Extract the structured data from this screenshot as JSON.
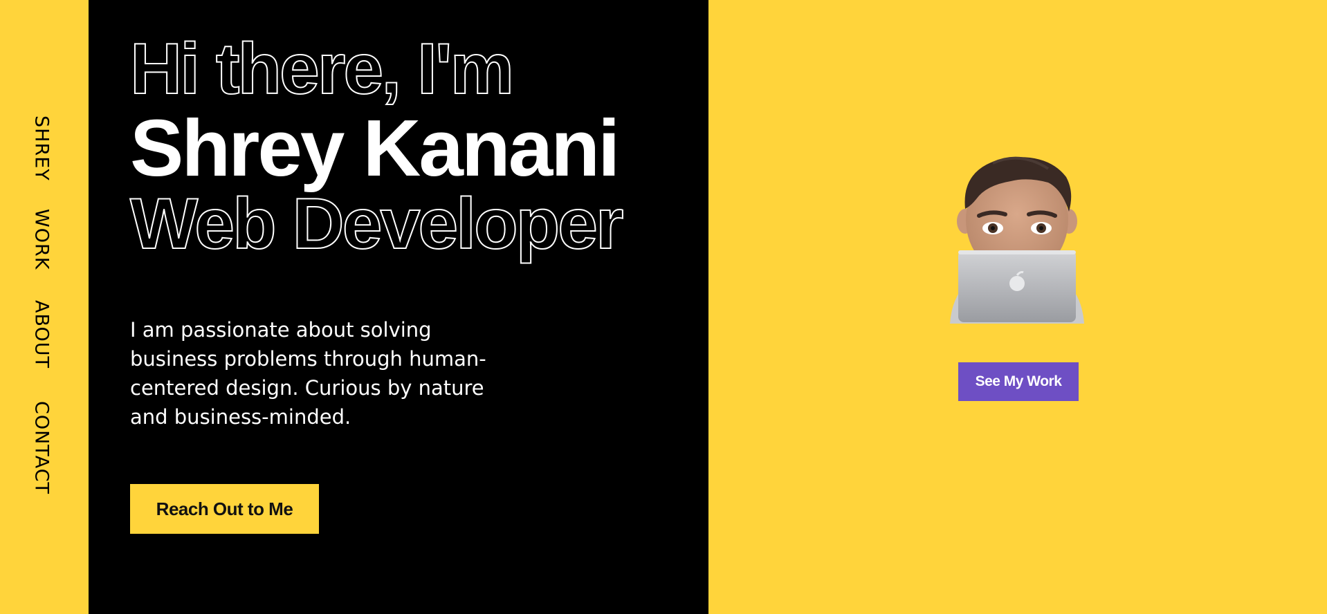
{
  "nav": {
    "items": [
      {
        "label": "SHREY"
      },
      {
        "label": "WORK"
      },
      {
        "label": "ABOUT"
      },
      {
        "label": "CONTACT"
      }
    ]
  },
  "hero": {
    "greeting": "Hi there, I'm",
    "name": "Shrey Kanani",
    "role": "Web Developer",
    "intro": "I am passionate about solving business problems through human-centered design. Curious by nature and business-minded.",
    "cta_label": "Reach Out to Me"
  },
  "showcase": {
    "avatar_icon": "memoji-laptop-icon",
    "button_label": "See My Work"
  },
  "colors": {
    "yellow": "#ffd43b",
    "black": "#000000",
    "purple": "#6e4fc4",
    "white": "#ffffff"
  }
}
